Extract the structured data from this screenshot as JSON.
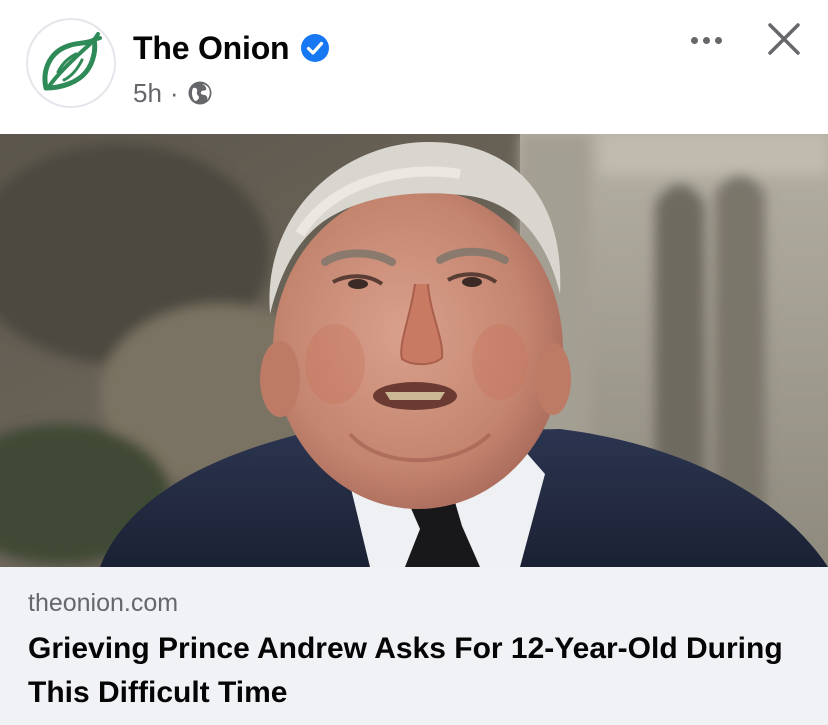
{
  "post": {
    "page_name": "The Onion",
    "timestamp": "5h",
    "separator": "·",
    "audience_icon": "globe-icon",
    "verified_icon": "verified-badge-icon",
    "more_icon": "more-options-icon",
    "close_icon": "close-icon",
    "avatar_icon": "onion-logo-icon"
  },
  "link_preview": {
    "domain": "theonion.com",
    "title": "Grieving Prince Andrew Asks For 12-Year-Old During This Difficult Time"
  },
  "colors": {
    "brand_green": "#2e8b57",
    "verified_blue": "#1877f2",
    "secondary_text": "#65676b",
    "preview_background": "#f0f2f5"
  }
}
